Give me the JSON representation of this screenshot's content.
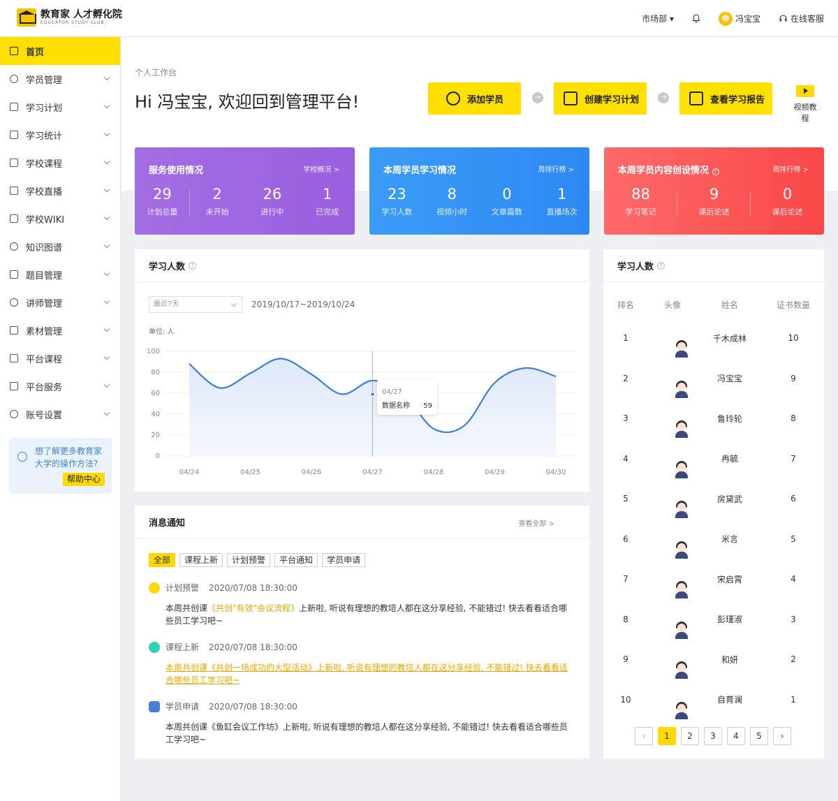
{
  "header": {
    "logo_title": "教育家 人才孵化院",
    "logo_sub": "EDUCATOR STUDY CLUB",
    "department": "市场部 ▾",
    "username": "冯宝宝",
    "service": "在线客服"
  },
  "sidebar": {
    "items": [
      {
        "label": "首页"
      },
      {
        "label": "学员管理"
      },
      {
        "label": "学习计划"
      },
      {
        "label": "学习统计"
      },
      {
        "label": "学校课程"
      },
      {
        "label": "学校直播"
      },
      {
        "label": "学校WIKI"
      },
      {
        "label": "知识图谱"
      },
      {
        "label": "题目管理"
      },
      {
        "label": "讲师管理"
      },
      {
        "label": "素材管理"
      },
      {
        "label": "平台课程"
      },
      {
        "label": "平台服务"
      },
      {
        "label": "账号设置"
      }
    ],
    "help_text": "想了解更多教育家大学的操作方法?",
    "help_button": "帮助中心"
  },
  "main": {
    "breadcrumb": "个人工作台",
    "greeting": "Hi 冯宝宝, 欢迎回到管理平台!",
    "quick_actions": [
      "添加学员",
      "创建学习计划",
      "查看学习报告"
    ],
    "video_tutorial": "视频教程"
  },
  "stats": [
    {
      "title": "服务使用情况",
      "link": "学校概况 >",
      "items": [
        {
          "num": "29",
          "label": "计划总量"
        },
        {
          "num": "2",
          "label": "未开始"
        },
        {
          "num": "26",
          "label": "进行中"
        },
        {
          "num": "1",
          "label": "已完成"
        }
      ]
    },
    {
      "title": "本周学员学习情况",
      "link": "周排行榜 >",
      "items": [
        {
          "num": "23",
          "label": "学习人数"
        },
        {
          "num": "8",
          "label": "视频小时"
        },
        {
          "num": "0",
          "label": "文章篇数"
        },
        {
          "num": "1",
          "label": "直播场次"
        }
      ]
    },
    {
      "title": "本周学员内容创设情况",
      "link": "周排行榜 >",
      "items": [
        {
          "num": "88",
          "label": "学习笔记"
        },
        {
          "num": "9",
          "label": "课后论述"
        },
        {
          "num": "0",
          "label": "课后论述"
        }
      ]
    }
  ],
  "chart_panel": {
    "title": "学习人数",
    "range_select": "最近7天",
    "date_range": "2019/10/17~2019/10/24",
    "unit": "单位: 人",
    "tooltip": {
      "date": "04/27",
      "name": "数据名称",
      "value": "59"
    }
  },
  "chart_data": {
    "type": "area",
    "categories": [
      "04/24",
      "04/25",
      "04/26",
      "04/27",
      "04/28",
      "04/29",
      "04/30"
    ],
    "x": [
      0,
      0.5,
      1,
      1.5,
      2,
      2.5,
      3,
      3.5,
      4,
      4.5,
      5,
      5.5,
      6
    ],
    "values": [
      88,
      65,
      93,
      59,
      73,
      25,
      76
    ],
    "curve": [
      88,
      65,
      79,
      93,
      78,
      59,
      72,
      60,
      26,
      29,
      70,
      84,
      76
    ],
    "ylim": [
      0,
      100
    ],
    "yticks": [
      0,
      20,
      40,
      60,
      80,
      100
    ],
    "grid": true,
    "color": "#3d7fd6"
  },
  "notices": {
    "title": "消息通知",
    "view_all": "查看全部 >",
    "filters": [
      "全部",
      "课程上新",
      "计划预警",
      "平台通知",
      "学员申请"
    ],
    "items": [
      {
        "type": "计划预警",
        "time": "2020/07/08 18:30:00",
        "body_pre": "本周共创课",
        "body_hl": "《共创\"有效\"会议流程》",
        "body_post": "上新啦, 听说有理想的教培人都在这分享经验, 不能错过! 快去看看适合哪些员工学习吧~"
      },
      {
        "type": "课程上新",
        "time": "2020/07/08 18:30:00",
        "body": "本周共创课《共创一场成功的大型活动》上新啦, 听说有理想的教培人都在这分享经验, 不能错过! 快去看看适合哪些员工学习吧~"
      },
      {
        "type": "学员申请",
        "time": "2020/07/08 18:30:00",
        "body": "本周共创课《鱼缸会议工作坊》上新啦, 听说有理想的教培人都在这分享经验, 不能错过! 快去看看适合哪些员工学习吧~"
      }
    ]
  },
  "ranking": {
    "title": "学习人数",
    "headers": [
      "排名",
      "头像",
      "姓名",
      "证书数量"
    ],
    "rows": [
      {
        "rank": "1",
        "name": "千木成林",
        "count": "10"
      },
      {
        "rank": "2",
        "name": "冯宝宝",
        "count": "9"
      },
      {
        "rank": "3",
        "name": "鲁玲轮",
        "count": "8"
      },
      {
        "rank": "4",
        "name": "冉毓",
        "count": "7"
      },
      {
        "rank": "5",
        "name": "房黛武",
        "count": "6"
      },
      {
        "rank": "6",
        "name": "米言",
        "count": "5"
      },
      {
        "rank": "7",
        "name": "宋启霄",
        "count": "4"
      },
      {
        "rank": "8",
        "name": "彭瑾淑",
        "count": "3"
      },
      {
        "rank": "9",
        "name": "和妍",
        "count": "2"
      },
      {
        "rank": "10",
        "name": "自育澜",
        "count": "1"
      }
    ],
    "pages": [
      "1",
      "2",
      "3",
      "4",
      "5"
    ]
  }
}
